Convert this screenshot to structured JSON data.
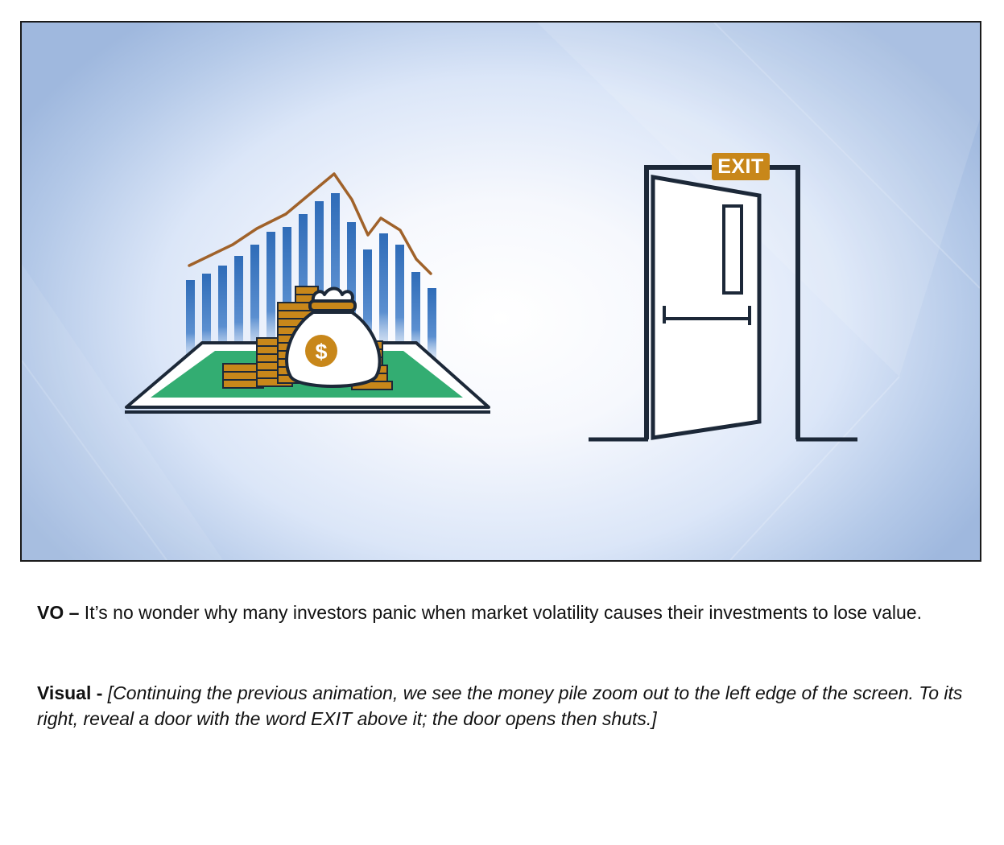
{
  "scene": {
    "exit_sign": "EXIT",
    "dollar_symbol": "$",
    "colors": {
      "bar_blue": "#3a76bf",
      "trend_brown": "#a0622a",
      "coin_gold": "#c8871a",
      "field_green": "#33ad72",
      "outline_navy": "#1c2838",
      "exit_orange": "#c8871a"
    },
    "icons": [
      "bar-chart-icon",
      "trend-line-icon",
      "coin-stack-icon",
      "money-bag-icon",
      "dollar-coin-icon",
      "exit-door-icon"
    ]
  },
  "vo": {
    "lead": "VO –",
    "text": " It’s no wonder why many investors panic when market volatility causes their investments to lose value."
  },
  "visual": {
    "lead": "Visual -",
    "text": " [Continuing the previous animation, we see the money pile zoom out to the left edge of the screen. To its right, reveal a door with the word EXIT above it; the door opens then shuts.]"
  }
}
